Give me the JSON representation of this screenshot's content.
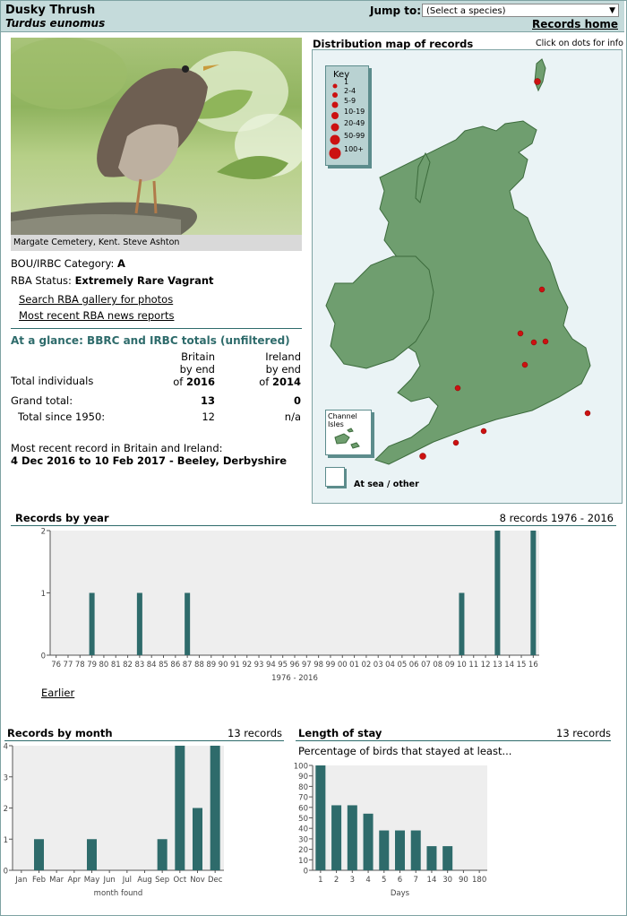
{
  "header": {
    "common_name": "Dusky Thrush",
    "latin_name": "Turdus eunomus",
    "jump_label": "Jump to:",
    "select_value": "(Select a species)",
    "records_home": "Records home"
  },
  "photo": {
    "caption": "Margate Cemetery, Kent. Steve Ashton"
  },
  "status": {
    "category_label": "BOU/IRBC Category:",
    "category_value": "A",
    "rba_label": "RBA Status:",
    "rba_value": "Extremely Rare Vagrant",
    "link_gallery": "Search RBA gallery for photos",
    "link_news": "Most recent RBA news reports"
  },
  "glance": {
    "title": "At a glance: BBRC and IRBC totals (unfiltered)",
    "col_britain": [
      "Britain",
      "by end",
      "of"
    ],
    "col_britain_year": "2016",
    "col_ireland": [
      "Ireland",
      "by end",
      "of"
    ],
    "col_ireland_year": "2014",
    "row_label_total_individuals": "Total individuals",
    "row_label_grand_total": "Grand total:",
    "grand_total_britain": "13",
    "grand_total_ireland": "0",
    "row_label_since_1950": "Total since 1950:",
    "since_1950_britain": "12",
    "since_1950_ireland": "n/a",
    "recent_label": "Most recent record in Britain and Ireland:",
    "recent_value": "4 Dec 2016 to 10 Feb 2017 - Beeley, Derbyshire"
  },
  "map": {
    "title": "Distribution map of records",
    "hint": "Click on dots for info",
    "key_title": "Key",
    "key_items": [
      "1",
      "2-4",
      "5-9",
      "10-19",
      "20-49",
      "50-99",
      "100+"
    ],
    "channel_isles": [
      "Channel",
      "Isles"
    ],
    "at_sea": "At sea / other",
    "colors": {
      "land": "#6f9e6f",
      "dot": "#cc1111",
      "key_bg": "#b9d2d2"
    }
  },
  "by_year": {
    "title": "Records by year",
    "summary": "8 records 1976 - 2016",
    "range_label": "1976 - 2016",
    "earlier_link": "Earlier"
  },
  "by_month": {
    "title": "Records by month",
    "summary": "13 records",
    "xlabel": "month found"
  },
  "stay": {
    "title": "Length of stay",
    "summary": "13 records",
    "subtitle": "Percentage of birds that stayed at least...",
    "xlabel": "Days"
  },
  "chart_data": [
    {
      "type": "bar",
      "title": "Records by year",
      "categories": [
        "76",
        "77",
        "78",
        "79",
        "80",
        "81",
        "82",
        "83",
        "84",
        "85",
        "86",
        "87",
        "88",
        "89",
        "90",
        "91",
        "92",
        "93",
        "94",
        "95",
        "96",
        "97",
        "98",
        "99",
        "00",
        "01",
        "02",
        "03",
        "04",
        "05",
        "06",
        "07",
        "08",
        "09",
        "10",
        "11",
        "12",
        "13",
        "14",
        "15",
        "16"
      ],
      "values": [
        0,
        0,
        0,
        1,
        0,
        0,
        0,
        1,
        0,
        0,
        0,
        1,
        0,
        0,
        0,
        0,
        0,
        0,
        0,
        0,
        0,
        0,
        0,
        0,
        0,
        0,
        0,
        0,
        0,
        0,
        0,
        0,
        0,
        0,
        1,
        0,
        0,
        2,
        0,
        0,
        2
      ],
      "xlabel": "1976 - 2016",
      "ylabel": "",
      "ylim": [
        0,
        2
      ],
      "yticks": [
        0,
        1,
        2
      ],
      "color": "#2e6b6b"
    },
    {
      "type": "bar",
      "title": "Records by month",
      "categories": [
        "Jan",
        "Feb",
        "Mar",
        "Apr",
        "May",
        "Jun",
        "Jul",
        "Aug",
        "Sep",
        "Oct",
        "Nov",
        "Dec"
      ],
      "values": [
        0,
        1,
        0,
        0,
        1,
        0,
        0,
        0,
        1,
        4,
        2,
        4
      ],
      "xlabel": "month found",
      "ylabel": "",
      "ylim": [
        0,
        4
      ],
      "yticks": [
        0,
        1,
        2,
        3,
        4
      ],
      "color": "#2e6b6b"
    },
    {
      "type": "bar",
      "title": "Length of stay",
      "categories": [
        "1",
        "2",
        "3",
        "4",
        "5",
        "6",
        "7",
        "14",
        "30",
        "90",
        "180"
      ],
      "values": [
        100,
        62,
        62,
        54,
        38,
        38,
        38,
        23,
        23,
        0,
        0
      ],
      "xlabel": "Days",
      "ylabel": "",
      "ylim": [
        0,
        100
      ],
      "yticks": [
        0,
        10,
        20,
        30,
        40,
        50,
        60,
        70,
        80,
        90,
        100
      ],
      "color": "#2e6b6b"
    }
  ]
}
